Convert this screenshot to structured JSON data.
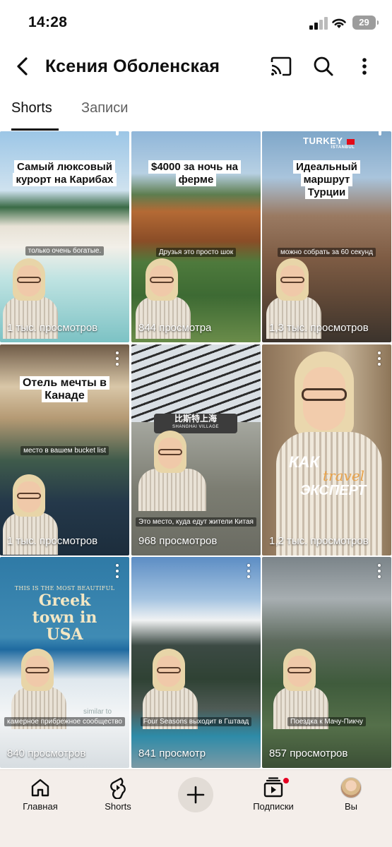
{
  "status_bar": {
    "time": "14:28",
    "battery": "29"
  },
  "header": {
    "title": "Ксения Оболенская",
    "icons": [
      "back-arrow-icon",
      "cast-icon",
      "search-icon",
      "more-vertical-icon"
    ]
  },
  "tabs": [
    {
      "label": "Shorts",
      "active": true
    },
    {
      "label": "Записи",
      "active": false
    }
  ],
  "shorts": [
    {
      "title": "Самый люксовый курорт на Карибах",
      "subtitle": "только очень богатые.",
      "views": "1 тыс. просмотров"
    },
    {
      "title": "$4000 за ночь на ферме",
      "subtitle": "Друзья это просто шок",
      "views": "844 просмотра"
    },
    {
      "title": "Идеальный маршрут Турции",
      "badge": "TURKEY",
      "badge_sub": "ISTANBUL",
      "subtitle": "можно собрать за 60 секунд",
      "views": "1,3 тыс. просмотров"
    },
    {
      "title": "Отель мечты в Канаде",
      "subtitle": "место в вашем bucket list",
      "views": "1 тыс. просмотров"
    },
    {
      "sign": "比斯特上海",
      "sign_sub": "SHANGHAI VILLAGE",
      "subtitle": "Это место, куда едут жители Китая",
      "views": "968 просмотров"
    },
    {
      "overlay_big": "КАК",
      "overlay_script": "travel",
      "overlay_big2": "ЭКСПЕРТ",
      "views": "1,2 тыс. просмотров"
    },
    {
      "kicker": "THIS IS THE MOST BEAUTIFUL",
      "headline": "Greek town in USA",
      "subtitle": "камерное прибрежное сообщество",
      "subtitle_faint": "similar to",
      "views": "840 просмотров"
    },
    {
      "subtitle": "Four Seasons выходит в Гштаад",
      "views": "841 просмотр"
    },
    {
      "subtitle": "Поездка к Мачу-Пикчу",
      "views": "857 просмотров"
    }
  ],
  "bottom_nav": [
    {
      "label": "Главная",
      "icon": "home-icon"
    },
    {
      "label": "Shorts",
      "icon": "shorts-icon"
    },
    {
      "label": "",
      "icon": "add-icon"
    },
    {
      "label": "Подписки",
      "icon": "subscriptions-icon"
    },
    {
      "label": "Вы",
      "icon": "avatar"
    }
  ],
  "colors": {
    "accent": "#e60023",
    "nav_bg": "#f4eeea",
    "text": "#0f0f0f"
  }
}
